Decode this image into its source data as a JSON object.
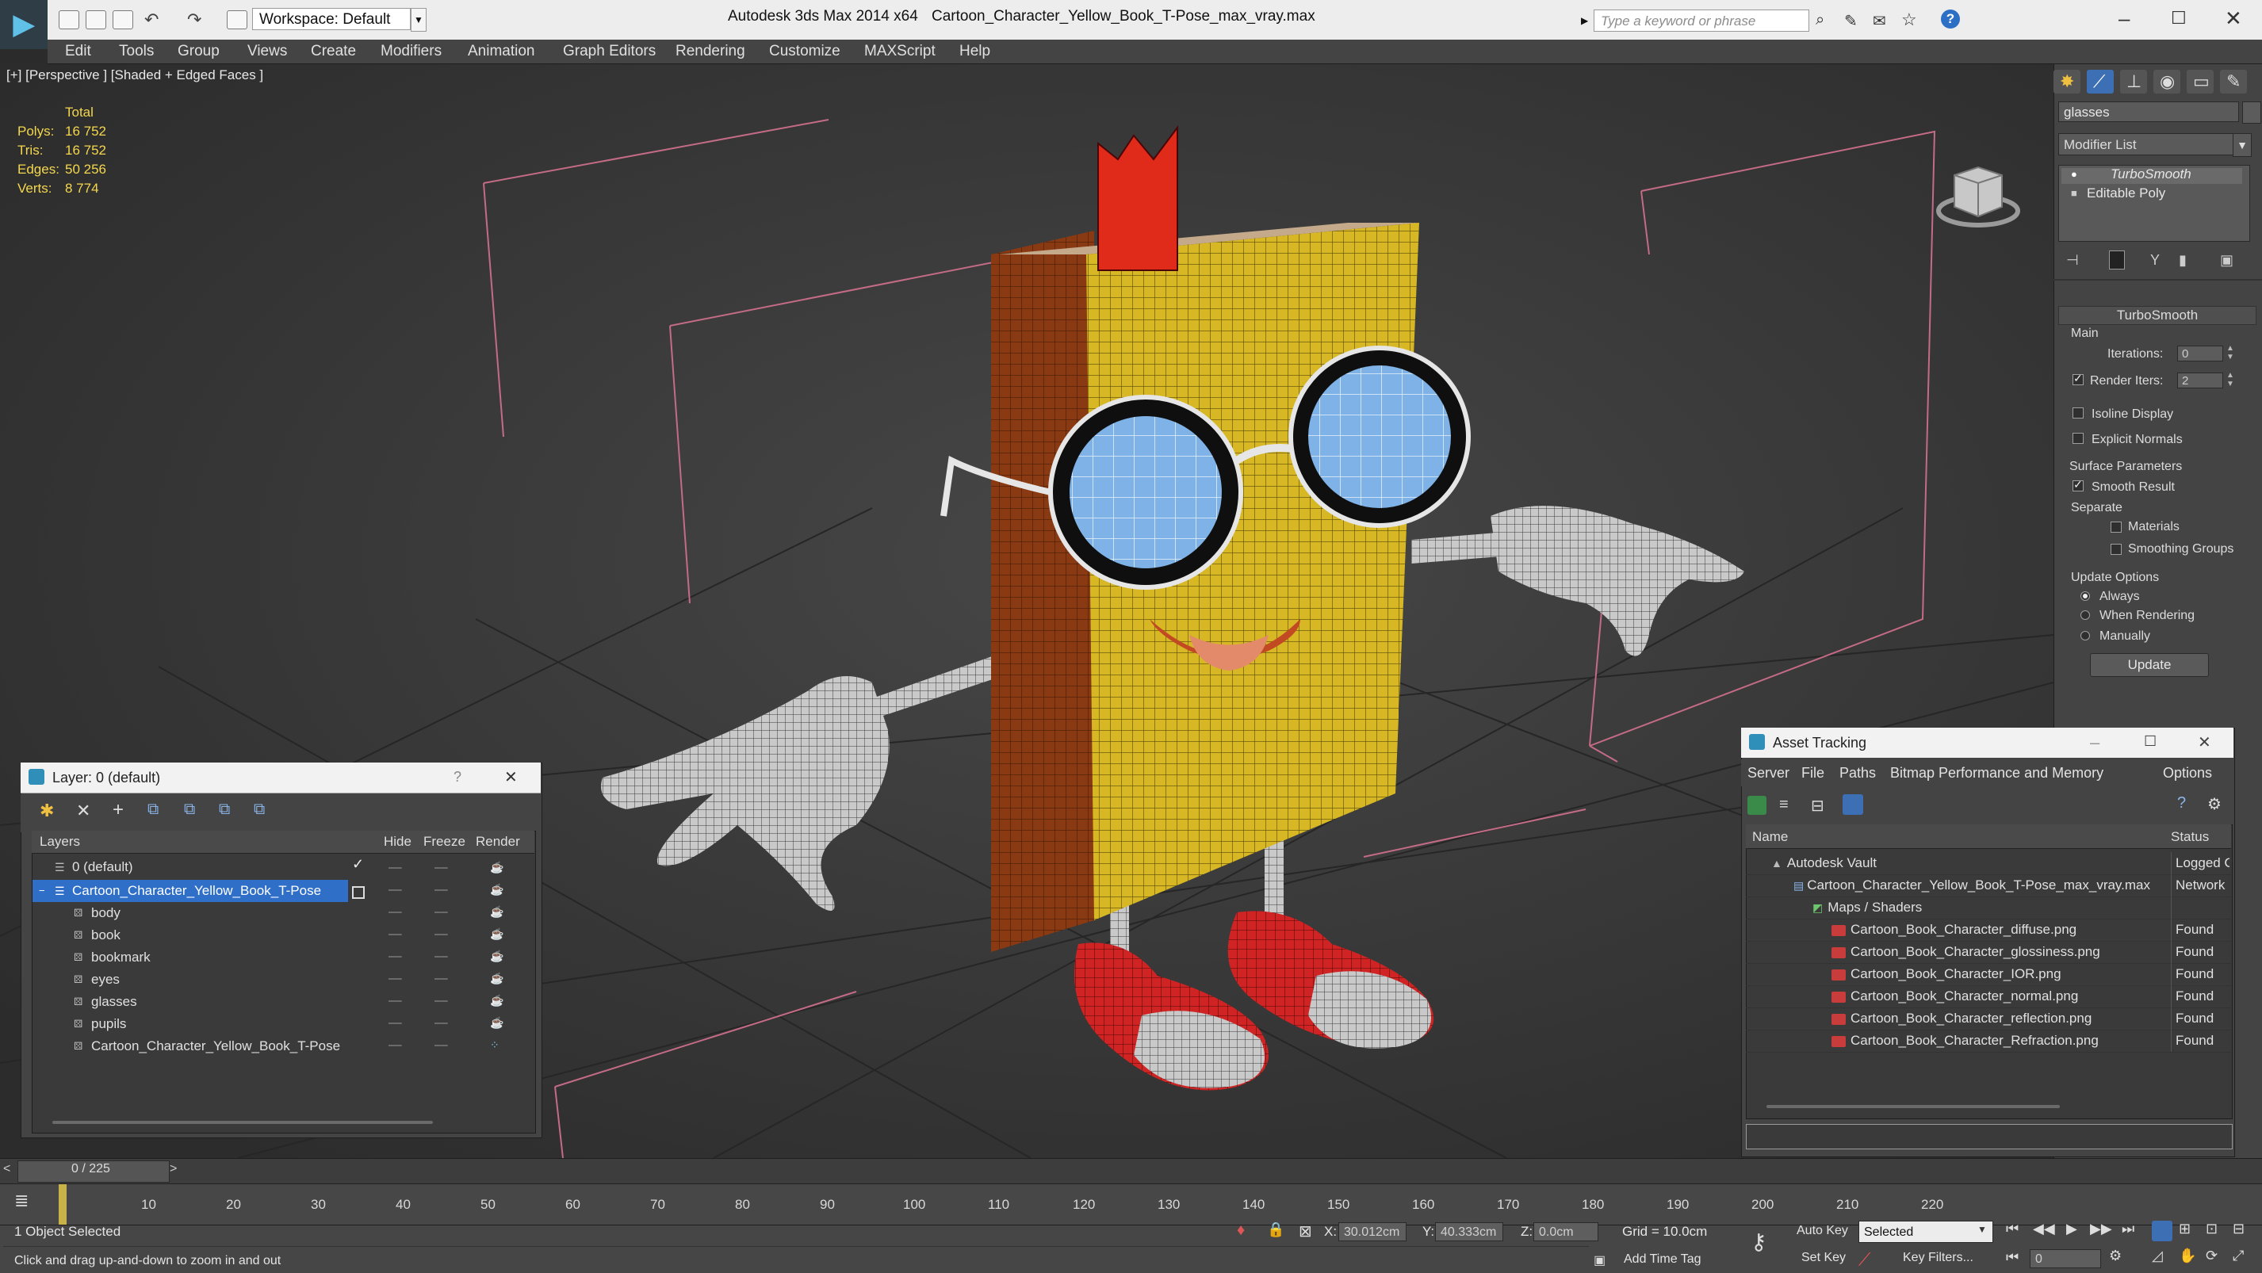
{
  "titlebar": {
    "app_title": "Autodesk 3ds Max  2014 x64",
    "file_title": "Cartoon_Character_Yellow_Book_T-Pose_max_vray.max",
    "workspace": "Workspace: Default",
    "search_placeholder": "Type a keyword or phrase"
  },
  "menubar": [
    "Edit",
    "Tools",
    "Group",
    "Views",
    "Create",
    "Modifiers",
    "Animation",
    "Graph Editors",
    "Rendering",
    "Customize",
    "MAXScript",
    "Help"
  ],
  "viewport": {
    "label": "[+] [Perspective ] [Shaded + Edged Faces ]",
    "stats": {
      "header": "Total",
      "rows": [
        {
          "label": "Polys:",
          "value": "16 752"
        },
        {
          "label": "Tris:",
          "value": "16 752"
        },
        {
          "label": "Edges:",
          "value": "50 256"
        },
        {
          "label": "Verts:",
          "value": "8 774"
        }
      ]
    }
  },
  "command_panel": {
    "object_name": "glasses",
    "modifier_list": "Modifier List",
    "stack": [
      "TurboSmooth",
      "Editable Poly"
    ],
    "rollout_title": "TurboSmooth",
    "main_label": "Main",
    "iterations_label": "Iterations:",
    "iterations_value": "0",
    "render_iters_label": "Render Iters:",
    "render_iters_value": "2",
    "isoline_display": "Isoline Display",
    "explicit_normals": "Explicit Normals",
    "surface_params_label": "Surface Parameters",
    "smooth_result": "Smooth Result",
    "separate_label": "Separate",
    "materials": "Materials",
    "smoothing_groups": "Smoothing Groups",
    "update_options_label": "Update Options",
    "always": "Always",
    "when_rendering": "When Rendering",
    "manually": "Manually",
    "update_button": "Update"
  },
  "layer_window": {
    "title": "Layer: 0 (default)",
    "help": "?",
    "columns": [
      "Layers",
      "Hide",
      "Freeze",
      "Render"
    ],
    "rows": [
      {
        "name": "0 (default)",
        "indent": 0
      },
      {
        "name": "Cartoon_Character_Yellow_Book_T-Pose",
        "indent": 0,
        "selected": true
      },
      {
        "name": "body",
        "indent": 1
      },
      {
        "name": "book",
        "indent": 1
      },
      {
        "name": "bookmark",
        "indent": 1
      },
      {
        "name": "eyes",
        "indent": 1
      },
      {
        "name": "glasses",
        "indent": 1
      },
      {
        "name": "pupils",
        "indent": 1
      },
      {
        "name": "Cartoon_Character_Yellow_Book_T-Pose",
        "indent": 1
      }
    ]
  },
  "asset_tracking": {
    "title": "Asset Tracking",
    "menu": [
      "Server",
      "File",
      "Paths",
      "Bitmap Performance and Memory",
      "Options"
    ],
    "columns": [
      "Name",
      "Status"
    ],
    "rows": [
      {
        "name": "Autodesk Vault",
        "status": "Logged O",
        "indent": 1
      },
      {
        "name": "Cartoon_Character_Yellow_Book_T-Pose_max_vray.max",
        "status": "Network",
        "indent": 2
      },
      {
        "name": "Maps / Shaders",
        "status": "",
        "indent": 3
      },
      {
        "name": "Cartoon_Book_Character_diffuse.png",
        "status": "Found",
        "indent": 4
      },
      {
        "name": "Cartoon_Book_Character_glossiness.png",
        "status": "Found",
        "indent": 4
      },
      {
        "name": "Cartoon_Book_Character_IOR.png",
        "status": "Found",
        "indent": 4
      },
      {
        "name": "Cartoon_Book_Character_normal.png",
        "status": "Found",
        "indent": 4
      },
      {
        "name": "Cartoon_Book_Character_reflection.png",
        "status": "Found",
        "indent": 4
      },
      {
        "name": "Cartoon_Book_Character_Refraction.png",
        "status": "Found",
        "indent": 4
      }
    ]
  },
  "timeline": {
    "frame_counter": "0 / 225",
    "ticks": [
      "10",
      "20",
      "30",
      "40",
      "50",
      "60",
      "70",
      "80",
      "90",
      "100",
      "110",
      "120",
      "130",
      "140",
      "150",
      "160",
      "170",
      "180",
      "190",
      "200",
      "210",
      "220"
    ]
  },
  "status": {
    "selection": "1 Object Selected",
    "hint": "Click and drag up-and-down to zoom in and out",
    "x_label": "X:",
    "x_value": "30.012cm",
    "y_label": "Y:",
    "y_value": "40.333cm",
    "z_label": "Z:",
    "z_value": "0.0cm",
    "grid": "Grid = 10.0cm",
    "add_time_tag": "Add Time Tag",
    "auto_key": "Auto Key",
    "set_key": "Set Key",
    "selected_dropdown": "Selected",
    "key_filters": "Key Filters...",
    "frame_value": "0"
  }
}
